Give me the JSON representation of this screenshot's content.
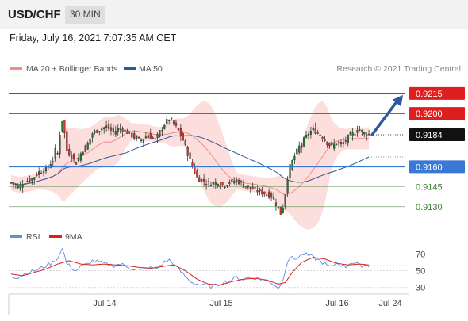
{
  "header": {
    "symbol": "USD/CHF",
    "timeframe": "30 MIN",
    "datetime": "Friday, July 16, 2021 7:07:35 AM CET"
  },
  "colors": {
    "candle_up": "#1d7a2e",
    "candle_down": "#d0332e",
    "bollinger_fill": "#fbd8d6",
    "ma20": "#f08c86",
    "ma50": "#2a5a9a",
    "resistance": "#dd1f1f",
    "support": "#3a78d6",
    "target": "#3f7f36",
    "arrow": "#2c5aa0",
    "rsi": "#5b8fe0",
    "rsi_ma": "#dd1f1f"
  },
  "chart_data": [
    {
      "type": "candlestick",
      "legend": [
        {
          "name": "MA 20 + Bollinger Bands",
          "color": "#f08c86"
        },
        {
          "name": "MA 50",
          "color": "#2a5a9a"
        }
      ],
      "annotation": "Research © 2021 Trading Central",
      "x_ticks": [
        "Jul 14",
        "Jul 15",
        "Jul 16",
        "Jul 24"
      ],
      "levels": [
        {
          "value": 0.9215,
          "label": "0.9215",
          "kind": "resistance"
        },
        {
          "value": 0.92,
          "label": "0.9200",
          "kind": "resistance"
        },
        {
          "value": 0.9184,
          "label": "0.9184",
          "kind": "last"
        },
        {
          "value": 0.916,
          "label": "0.9160",
          "kind": "support"
        },
        {
          "value": 0.9145,
          "label": "0.9145",
          "kind": "target"
        },
        {
          "value": 0.913,
          "label": "0.9130",
          "kind": "target"
        }
      ],
      "ylim": [
        0.9115,
        0.9228
      ],
      "x_range": [
        0,
        170
      ],
      "close_path": [
        [
          0,
          0.9148
        ],
        [
          3,
          0.9145
        ],
        [
          6,
          0.9149
        ],
        [
          9,
          0.9151
        ],
        [
          12,
          0.9156
        ],
        [
          15,
          0.9158
        ],
        [
          18,
          0.9165
        ],
        [
          19,
          0.9172
        ],
        [
          20,
          0.917
        ],
        [
          21,
          0.9185
        ],
        [
          22,
          0.9195
        ],
        [
          23,
          0.9185
        ],
        [
          24,
          0.9172
        ],
        [
          26,
          0.9168
        ],
        [
          28,
          0.9163
        ],
        [
          30,
          0.917
        ],
        [
          33,
          0.9177
        ],
        [
          35,
          0.9185
        ],
        [
          38,
          0.9188
        ],
        [
          41,
          0.919
        ],
        [
          44,
          0.9186
        ],
        [
          47,
          0.9189
        ],
        [
          50,
          0.9186
        ],
        [
          53,
          0.9182
        ],
        [
          56,
          0.918
        ],
        [
          59,
          0.9184
        ],
        [
          62,
          0.918
        ],
        [
          64,
          0.9186
        ],
        [
          66,
          0.9192
        ],
        [
          68,
          0.9196
        ],
        [
          70,
          0.9192
        ],
        [
          72,
          0.9187
        ],
        [
          74,
          0.918
        ],
        [
          76,
          0.917
        ],
        [
          78,
          0.916
        ],
        [
          80,
          0.9152
        ],
        [
          82,
          0.915
        ],
        [
          85,
          0.9147
        ],
        [
          88,
          0.9148
        ],
        [
          91,
          0.9146
        ],
        [
          94,
          0.9148
        ],
        [
          97,
          0.915
        ],
        [
          100,
          0.9146
        ],
        [
          103,
          0.9144
        ],
        [
          106,
          0.9142
        ],
        [
          109,
          0.914
        ],
        [
          112,
          0.9138
        ],
        [
          114,
          0.9132
        ],
        [
          115,
          0.9128
        ],
        [
          116,
          0.9125
        ],
        [
          117,
          0.913
        ],
        [
          118,
          0.914
        ],
        [
          119,
          0.9152
        ],
        [
          120,
          0.916
        ],
        [
          122,
          0.9168
        ],
        [
          124,
          0.9175
        ],
        [
          126,
          0.918
        ],
        [
          128,
          0.9185
        ],
        [
          130,
          0.9188
        ],
        [
          132,
          0.9185
        ],
        [
          134,
          0.9182
        ],
        [
          136,
          0.9178
        ],
        [
          138,
          0.9175
        ],
        [
          140,
          0.9178
        ],
        [
          142,
          0.9176
        ],
        [
          144,
          0.918
        ],
        [
          146,
          0.9184
        ],
        [
          148,
          0.9186
        ],
        [
          150,
          0.9188
        ],
        [
          152,
          0.9185
        ],
        [
          154,
          0.9184
        ]
      ]
    },
    {
      "type": "line",
      "legend": [
        {
          "name": "RSI",
          "color": "#5b8fe0"
        },
        {
          "name": "9MA",
          "color": "#dd1f1f"
        }
      ],
      "y_ticks": [
        70,
        50,
        30
      ],
      "ylim": [
        25,
        78
      ],
      "rsi": [
        [
          0,
          44
        ],
        [
          3,
          42
        ],
        [
          6,
          47
        ],
        [
          9,
          49
        ],
        [
          12,
          52
        ],
        [
          15,
          56
        ],
        [
          18,
          60
        ],
        [
          20,
          65
        ],
        [
          21,
          72
        ],
        [
          22,
          76
        ],
        [
          23,
          68
        ],
        [
          24,
          58
        ],
        [
          26,
          54
        ],
        [
          28,
          50
        ],
        [
          30,
          55
        ],
        [
          33,
          58
        ],
        [
          35,
          62
        ],
        [
          38,
          60
        ],
        [
          41,
          58
        ],
        [
          44,
          56
        ],
        [
          47,
          58
        ],
        [
          50,
          55
        ],
        [
          53,
          52
        ],
        [
          56,
          50
        ],
        [
          59,
          54
        ],
        [
          62,
          51
        ],
        [
          64,
          56
        ],
        [
          66,
          60
        ],
        [
          68,
          63
        ],
        [
          70,
          58
        ],
        [
          72,
          52
        ],
        [
          74,
          46
        ],
        [
          76,
          40
        ],
        [
          78,
          36
        ],
        [
          80,
          34
        ],
        [
          82,
          33
        ],
        [
          85,
          31
        ],
        [
          88,
          32
        ],
        [
          91,
          36
        ],
        [
          94,
          38
        ],
        [
          97,
          42
        ],
        [
          100,
          40
        ],
        [
          103,
          42
        ],
        [
          106,
          41
        ],
        [
          109,
          38
        ],
        [
          112,
          36
        ],
        [
          114,
          32
        ],
        [
          115,
          30
        ],
        [
          116,
          32
        ],
        [
          117,
          40
        ],
        [
          118,
          52
        ],
        [
          119,
          62
        ],
        [
          120,
          66
        ],
        [
          122,
          64
        ],
        [
          124,
          67
        ],
        [
          126,
          70
        ],
        [
          128,
          68
        ],
        [
          130,
          66
        ],
        [
          132,
          63
        ],
        [
          134,
          60
        ],
        [
          136,
          56
        ],
        [
          138,
          54
        ],
        [
          140,
          60
        ],
        [
          142,
          57
        ],
        [
          144,
          55
        ],
        [
          146,
          60
        ],
        [
          148,
          59
        ],
        [
          150,
          56
        ],
        [
          152,
          57
        ],
        [
          154,
          56
        ]
      ],
      "rsi_ma": [
        [
          0,
          46
        ],
        [
          5,
          44
        ],
        [
          10,
          48
        ],
        [
          15,
          52
        ],
        [
          20,
          58
        ],
        [
          25,
          62
        ],
        [
          30,
          58
        ],
        [
          35,
          57
        ],
        [
          40,
          58
        ],
        [
          45,
          57
        ],
        [
          50,
          56
        ],
        [
          55,
          54
        ],
        [
          60,
          53
        ],
        [
          65,
          55
        ],
        [
          70,
          57
        ],
        [
          75,
          50
        ],
        [
          80,
          40
        ],
        [
          85,
          34
        ],
        [
          90,
          33
        ],
        [
          95,
          37
        ],
        [
          100,
          40
        ],
        [
          105,
          41
        ],
        [
          110,
          39
        ],
        [
          115,
          34
        ],
        [
          118,
          36
        ],
        [
          121,
          48
        ],
        [
          125,
          60
        ],
        [
          130,
          66
        ],
        [
          135,
          64
        ],
        [
          140,
          59
        ],
        [
          145,
          57
        ],
        [
          150,
          58
        ],
        [
          154,
          57
        ]
      ],
      "last_value": 56
    }
  ]
}
